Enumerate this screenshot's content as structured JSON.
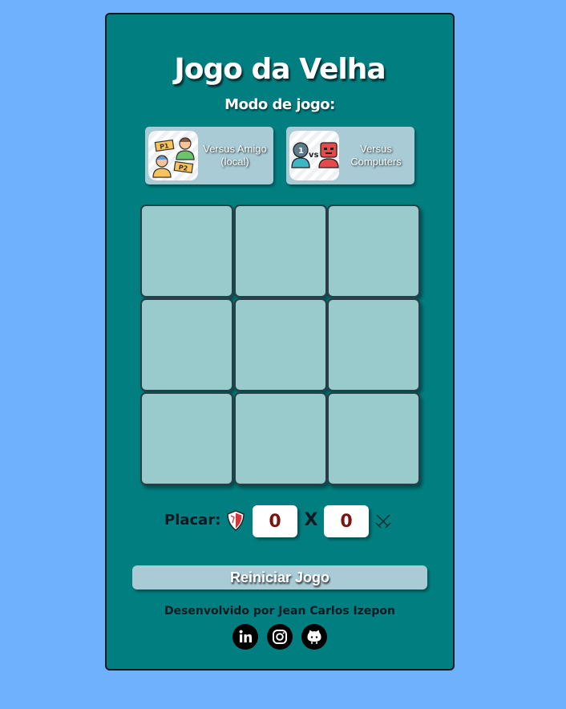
{
  "title": "Jogo da Velha",
  "mode": {
    "label": "Modo de jogo:",
    "options": [
      {
        "label": "Versus Amigo (local)",
        "icon": "two-players-icon"
      },
      {
        "label": "Versus Computers",
        "icon": "player-vs-robot-icon"
      }
    ]
  },
  "board": {
    "cells": [
      "",
      "",
      "",
      "",
      "",
      "",
      "",
      "",
      ""
    ]
  },
  "score": {
    "label": "Placar:",
    "player1_icon": "shield-icon",
    "player1": "0",
    "separator": "X",
    "player2": "0",
    "player2_icon": "crossed-swords-icon"
  },
  "restart_label": "Reiniciar Jogo",
  "footer": {
    "credit": "Desenvolvido por Jean Carlos Izepon",
    "social": [
      {
        "icon": "linkedin-icon"
      },
      {
        "icon": "instagram-icon"
      },
      {
        "icon": "github-icon"
      }
    ]
  },
  "colors": {
    "page_background": "#6fb1fd",
    "card_background": "#017f80",
    "cell_background": "#9acbcc",
    "button_background": "#a8cbd6",
    "score_text": "#7a1410"
  }
}
